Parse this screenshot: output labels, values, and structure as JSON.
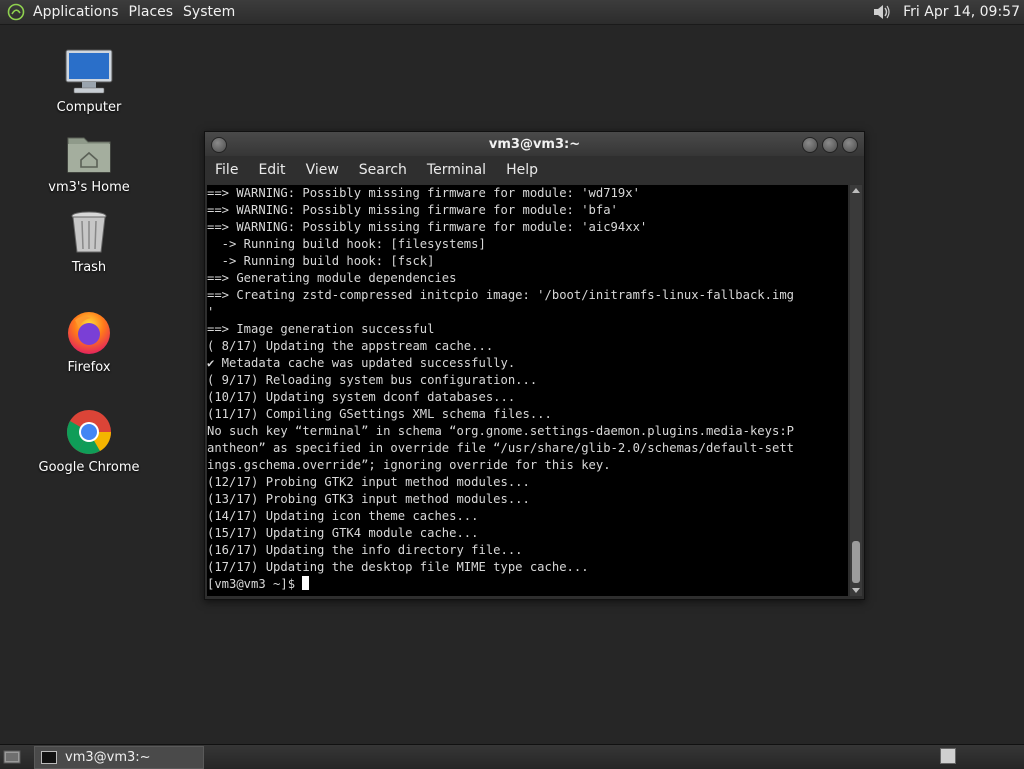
{
  "top_panel": {
    "menus": [
      "Applications",
      "Places",
      "System"
    ],
    "clock": "Fri Apr 14, 09:57",
    "volume_icon": "speaker-icon"
  },
  "desktop_icons": [
    {
      "label": "Computer",
      "icon": "computer-icon"
    },
    {
      "label": "vm3's Home",
      "icon": "home-folder-icon"
    },
    {
      "label": "Trash",
      "icon": "trash-icon"
    },
    {
      "label": "Firefox",
      "icon": "firefox-icon"
    },
    {
      "label": "Google Chrome",
      "icon": "chrome-icon"
    }
  ],
  "window": {
    "title": "vm3@vm3:~",
    "menu": [
      "File",
      "Edit",
      "View",
      "Search",
      "Terminal",
      "Help"
    ],
    "lines": [
      "==> WARNING: Possibly missing firmware for module: 'wd719x'",
      "==> WARNING: Possibly missing firmware for module: 'bfa'",
      "==> WARNING: Possibly missing firmware for module: 'aic94xx'",
      "  -> Running build hook: [filesystems]",
      "  -> Running build hook: [fsck]",
      "==> Generating module dependencies",
      "==> Creating zstd-compressed initcpio image: '/boot/initramfs-linux-fallback.img",
      "'",
      "==> Image generation successful",
      "( 8/17) Updating the appstream cache...",
      "✔ Metadata cache was updated successfully.",
      "( 9/17) Reloading system bus configuration...",
      "(10/17) Updating system dconf databases...",
      "(11/17) Compiling GSettings XML schema files...",
      "No such key “terminal” in schema “org.gnome.settings-daemon.plugins.media-keys:P",
      "antheon” as specified in override file “/usr/share/glib-2.0/schemas/default-sett",
      "ings.gschema.override”; ignoring override for this key.",
      "(12/17) Probing GTK2 input method modules...",
      "(13/17) Probing GTK3 input method modules...",
      "(14/17) Updating icon theme caches...",
      "(15/17) Updating GTK4 module cache...",
      "(16/17) Updating the info directory file...",
      "(17/17) Updating the desktop file MIME type cache...",
      "[vm3@vm3 ~]$ "
    ]
  },
  "taskbar": {
    "task_label": "vm3@vm3:~"
  },
  "colors": {
    "panel": "#2c2c2c",
    "desktop": "#262626",
    "terminal_bg": "#000000",
    "terminal_fg": "#d8d8d8"
  }
}
